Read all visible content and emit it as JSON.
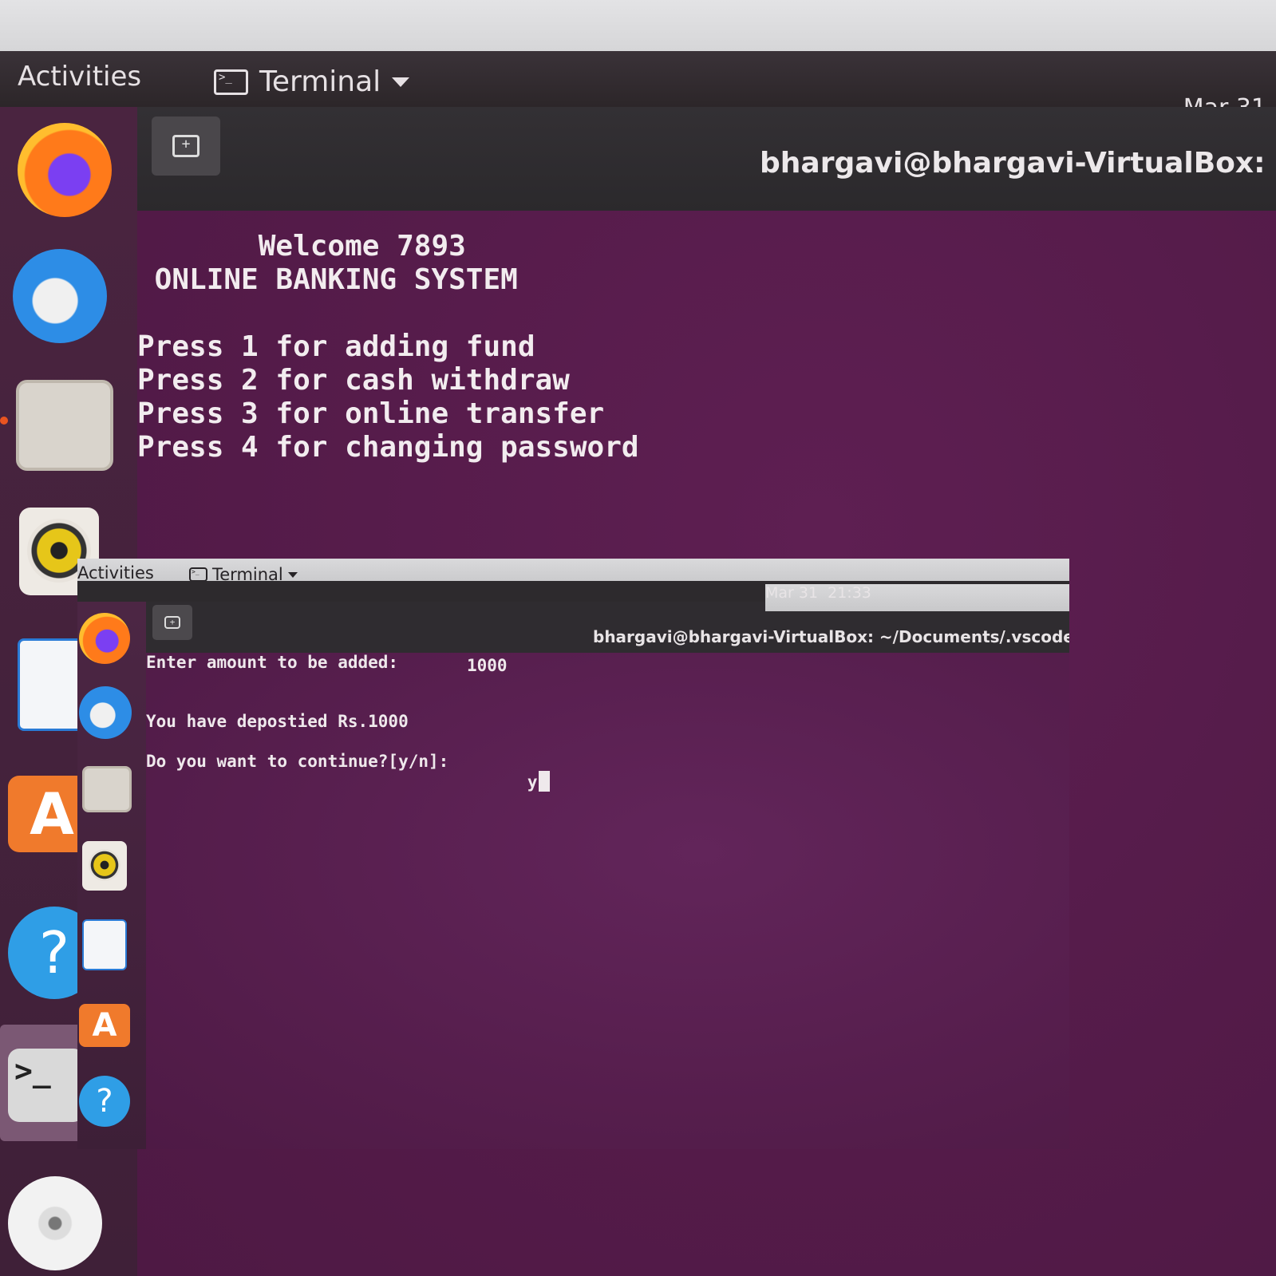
{
  "background": {
    "topbar": {
      "activities_label": "Activities",
      "app_menu_label": "Terminal",
      "date": "Mar 31"
    },
    "dock": {
      "apps": [
        "firefox-icon",
        "thunderbird-icon",
        "files-icon",
        "rhythmbox-icon",
        "writer-icon",
        "software-icon",
        "help-icon",
        "terminal-icon",
        "disc-icon"
      ]
    },
    "terminal": {
      "new_tab_icon": "new-tab-icon",
      "window_title": "bhargavi@bhargavi-VirtualBox: ~/Docum",
      "output": {
        "line1": "       Welcome 7893",
        "line2": " ONLINE BANKING SYSTEM",
        "line3": "",
        "line4": "Press 1 for adding fund",
        "line5": "Press 2 for cash withdraw",
        "line6": "Press 3 for online transfer",
        "line7": "Press 4 for changing password"
      }
    }
  },
  "overlay": {
    "topbar": {
      "activities_label": "Activities",
      "app_menu_label": "Terminal",
      "date": "Mar 31",
      "time": "21:33"
    },
    "dock": {
      "apps": [
        "firefox-icon",
        "thunderbird-icon",
        "files-icon",
        "rhythmbox-icon",
        "writer-icon",
        "software-icon",
        "help-icon"
      ]
    },
    "terminal": {
      "new_tab_icon": "new-tab-icon",
      "window_title": "bhargavi@bhargavi-VirtualBox: ~/Documents/.vscode/Online_Banking_Syst",
      "prompt_amount": "Enter amount to be added:",
      "amount_value": "1000",
      "deposit_message": "You have depostied Rs.1000",
      "prompt_continue": "Do you want to continue?[y/n]:",
      "continue_value": "y"
    }
  },
  "colors": {
    "terminal_bg": "#541b49",
    "topbar_bg": "#2c2629",
    "text": "#f2ecef"
  }
}
